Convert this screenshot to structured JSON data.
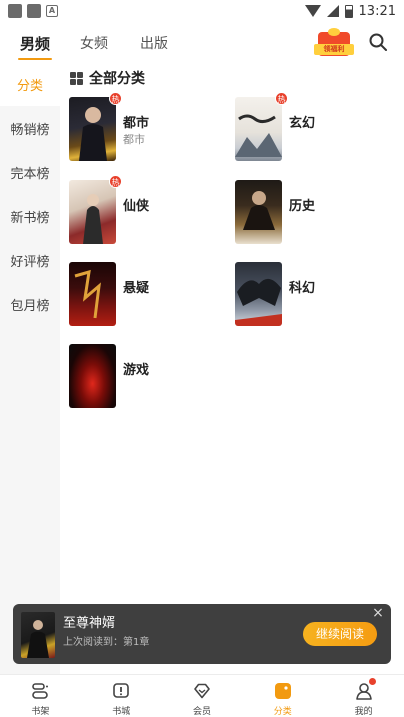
{
  "status_bar": {
    "time": "13:21",
    "notification_letter": "A"
  },
  "top_tabs": [
    {
      "label": "男频",
      "active": true
    },
    {
      "label": "女频",
      "active": false
    },
    {
      "label": "出版",
      "active": false
    }
  ],
  "gift_badge": {
    "label": "领福利"
  },
  "sidebar": {
    "items": [
      {
        "label": "分类",
        "active": true
      },
      {
        "label": "畅销榜",
        "active": false
      },
      {
        "label": "完本榜",
        "active": false
      },
      {
        "label": "新书榜",
        "active": false
      },
      {
        "label": "好评榜",
        "active": false
      },
      {
        "label": "包月榜",
        "active": false
      }
    ]
  },
  "section": {
    "title": "全部分类"
  },
  "hot_badge": "热",
  "categories": [
    {
      "name": "都市",
      "subtitle": "都市",
      "hot": true
    },
    {
      "name": "玄幻",
      "subtitle": "",
      "hot": true
    },
    {
      "name": "仙侠",
      "subtitle": "",
      "hot": true
    },
    {
      "name": "历史",
      "subtitle": "",
      "hot": false
    },
    {
      "name": "悬疑",
      "subtitle": "",
      "hot": false
    },
    {
      "name": "科幻",
      "subtitle": "",
      "hot": false
    },
    {
      "name": "游戏",
      "subtitle": "",
      "hot": false
    }
  ],
  "continue_reading": {
    "book_title": "至尊神婿",
    "last_read": "上次阅读到：第1章",
    "button_label": "继续阅读",
    "close_icon": "×"
  },
  "bottom_nav": [
    {
      "label": "书架",
      "icon": "bookshelf-icon",
      "active": false
    },
    {
      "label": "书城",
      "icon": "bookstore-icon",
      "active": false
    },
    {
      "label": "会员",
      "icon": "vip-diamond-icon",
      "active": false
    },
    {
      "label": "分类",
      "icon": "category-icon",
      "active": true
    },
    {
      "label": "我的",
      "icon": "profile-icon",
      "active": false
    }
  ],
  "colors": {
    "accent": "#f29a10",
    "hot": "#e8412c",
    "banner_bg": "#3f3f3f"
  }
}
